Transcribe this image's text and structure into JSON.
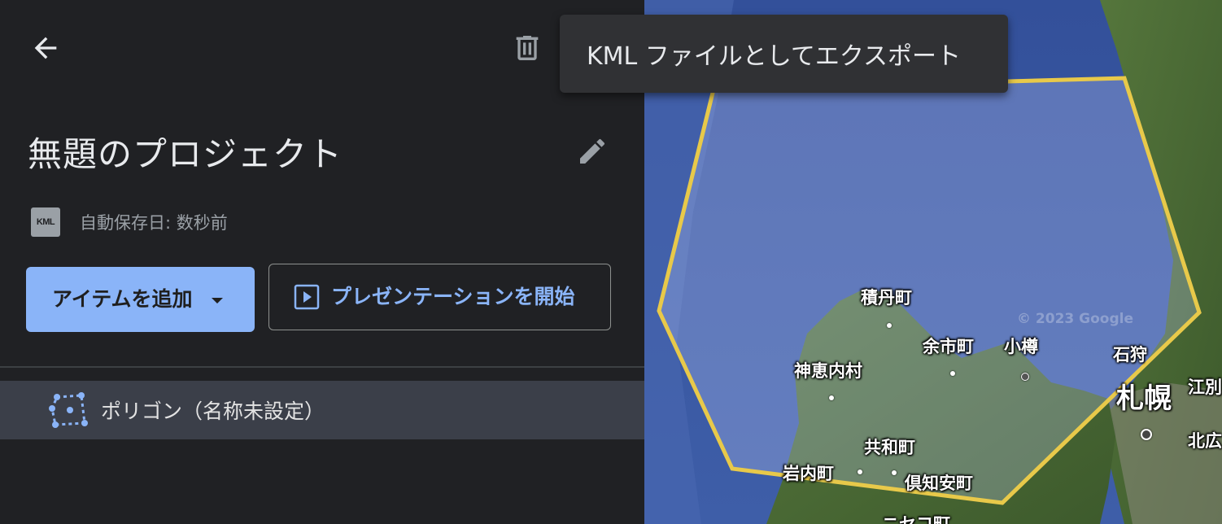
{
  "panel": {
    "back_icon": "arrow-back-icon",
    "delete_icon": "trash-icon",
    "title": "無題のプロジェクト",
    "edit_icon": "pencil-icon",
    "file_badge": "KML",
    "autosave_status": "自動保存日: 数秒前",
    "add_item_button": "アイテムを追加",
    "add_item_caret_icon": "caret-down-icon",
    "present_button": "プレゼンテーションを開始",
    "present_icon": "play-box-icon",
    "items": [
      {
        "icon": "polygon-icon",
        "label": "ポリゴン（名称未設定）"
      }
    ]
  },
  "tooltip": {
    "text": "KML ファイルとしてエクスポート"
  },
  "map": {
    "copyright": "© 2023 Google",
    "places": {
      "shakotan": "積丹町",
      "yoichi": "余市町",
      "otaru": "小樽",
      "ishikari": "石狩",
      "sapporo": "札幌",
      "ebetsu": "江別",
      "kamoenai": "神恵内村",
      "kyowa": "共和町",
      "iwanai": "岩内町",
      "kutchan": "倶知安町",
      "kitahiroshima": "北広",
      "niseko": "ニセコ町"
    },
    "colors": {
      "polygon_stroke": "#e8c94a",
      "sea": "#3e5ea8",
      "land": "#4b6b37"
    }
  },
  "colors": {
    "accent": "#8ab4f8",
    "panel_bg": "#202124",
    "selected_row": "#3b3f49"
  }
}
